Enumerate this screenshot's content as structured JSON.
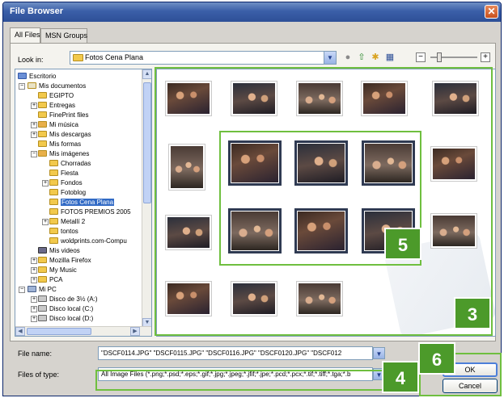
{
  "window": {
    "title": "File Browser"
  },
  "tabs": [
    {
      "label": "All Files"
    },
    {
      "label": "MSN Groups"
    }
  ],
  "toolbar": {
    "look_in_label": "Look in:",
    "look_in_value": "Fotos Cena Plana"
  },
  "tree": {
    "items": [
      {
        "label": "Escritorio"
      },
      {
        "label": "Mis documentos"
      },
      {
        "label": "EGIPTO"
      },
      {
        "label": "Entregas"
      },
      {
        "label": "FinePrint files"
      },
      {
        "label": "Mi música"
      },
      {
        "label": "Mis descargas"
      },
      {
        "label": "Mis formas"
      },
      {
        "label": "Mis imágenes"
      },
      {
        "label": "Chorradas"
      },
      {
        "label": "Fiesta"
      },
      {
        "label": "Fondos"
      },
      {
        "label": "Fotoblog"
      },
      {
        "label": "Fotos Cena Plana"
      },
      {
        "label": "FOTOS PREMIOS 2005"
      },
      {
        "label": "Metallí 2"
      },
      {
        "label": "tontos"
      },
      {
        "label": "woldprints.com-Compu"
      },
      {
        "label": "Mis videos"
      },
      {
        "label": "Mozilla Firefox"
      },
      {
        "label": "My Music"
      },
      {
        "label": "PCA"
      },
      {
        "label": "Mi PC"
      },
      {
        "label": "Disco de 3½ (A:)"
      },
      {
        "label": "Disco local (C:)"
      },
      {
        "label": "Disco local (D:)"
      }
    ]
  },
  "bottom": {
    "file_name_label": "File name:",
    "file_name_value": "\"DSCF0114.JPG\" \"DSCF0115.JPG\" \"DSCF0116.JPG\" \"DSCF0120.JPG\" \"DSCF012",
    "file_type_label": "Files of type:",
    "file_type_value": "All Image Files (*.png;*.psd;*.eps;*.gif;*.jpg;*.jpeg;*.jfif;*.jpe;*.pcd;*.pcx;*.tif;*.tiff;*.tga;*.b",
    "ok_label": "OK",
    "cancel_label": "Cancel"
  },
  "callouts": {
    "c3": "3",
    "c4": "4",
    "c5": "5",
    "c6": "6"
  },
  "colors": {
    "callout": "#4c9a2a",
    "highlight": "#6fbf3f",
    "selection": "#316ac5",
    "titlebar": "#3b5fa8"
  }
}
